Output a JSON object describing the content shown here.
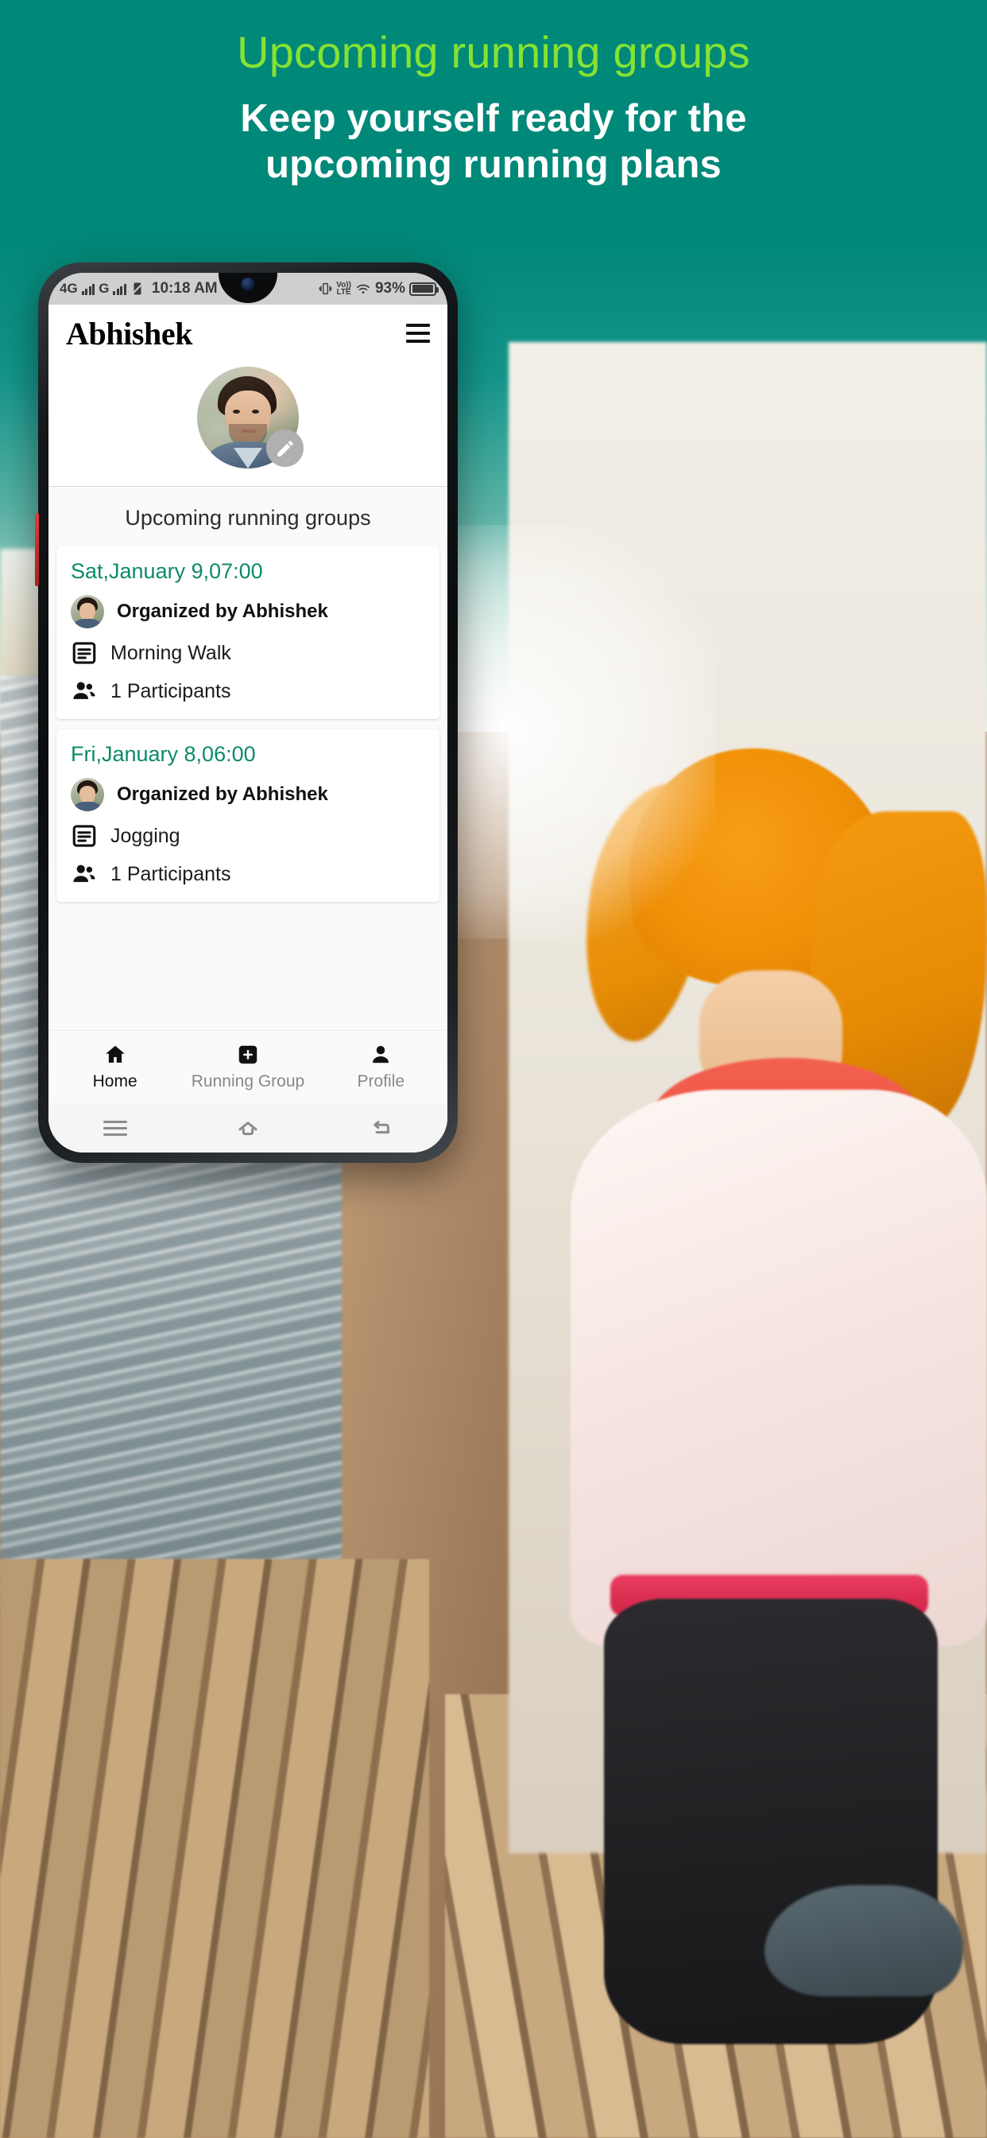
{
  "promo": {
    "title": "Upcoming running groups",
    "subtitle_line1": "Keep yourself ready for the",
    "subtitle_line2": "upcoming running plans",
    "title_color": "#85e232",
    "subtitle_color": "#ffffff",
    "background_color": "#008878"
  },
  "statusbar": {
    "network_1": "4G",
    "network_2": "G",
    "time": "10:18 AM",
    "volte_top": "Vo))",
    "volte_bottom": "LTE",
    "battery_percent": "93%"
  },
  "appbar": {
    "title": "Abhishek",
    "menu_icon": "hamburger-icon"
  },
  "profile": {
    "avatar_alt": "Abhishek profile photo",
    "edit_icon": "pencil-icon"
  },
  "section": {
    "heading": "Upcoming running groups"
  },
  "cards": [
    {
      "date": "Sat,January 9,07:00",
      "organizer": "Organized by Abhishek",
      "activity": "Morning Walk",
      "activity_icon": "article-icon",
      "participants": "1 Participants",
      "participants_icon": "people-icon",
      "date_color": "#0c8a6a"
    },
    {
      "date": "Fri,January 8,06:00",
      "organizer": "Organized by Abhishek",
      "activity": "Jogging",
      "activity_icon": "article-icon",
      "participants": "1 Participants",
      "participants_icon": "people-icon",
      "date_color": "#0c8a6a"
    }
  ],
  "bottom_nav": {
    "items": [
      {
        "label": "Home",
        "icon": "home-icon",
        "active": true
      },
      {
        "label": "Running Group",
        "icon": "plus-square-icon",
        "active": false
      },
      {
        "label": "Profile",
        "icon": "person-icon",
        "active": false
      }
    ]
  },
  "system_nav": {
    "items": [
      {
        "name": "recents-icon"
      },
      {
        "name": "home-outline-icon"
      },
      {
        "name": "back-icon"
      }
    ]
  }
}
